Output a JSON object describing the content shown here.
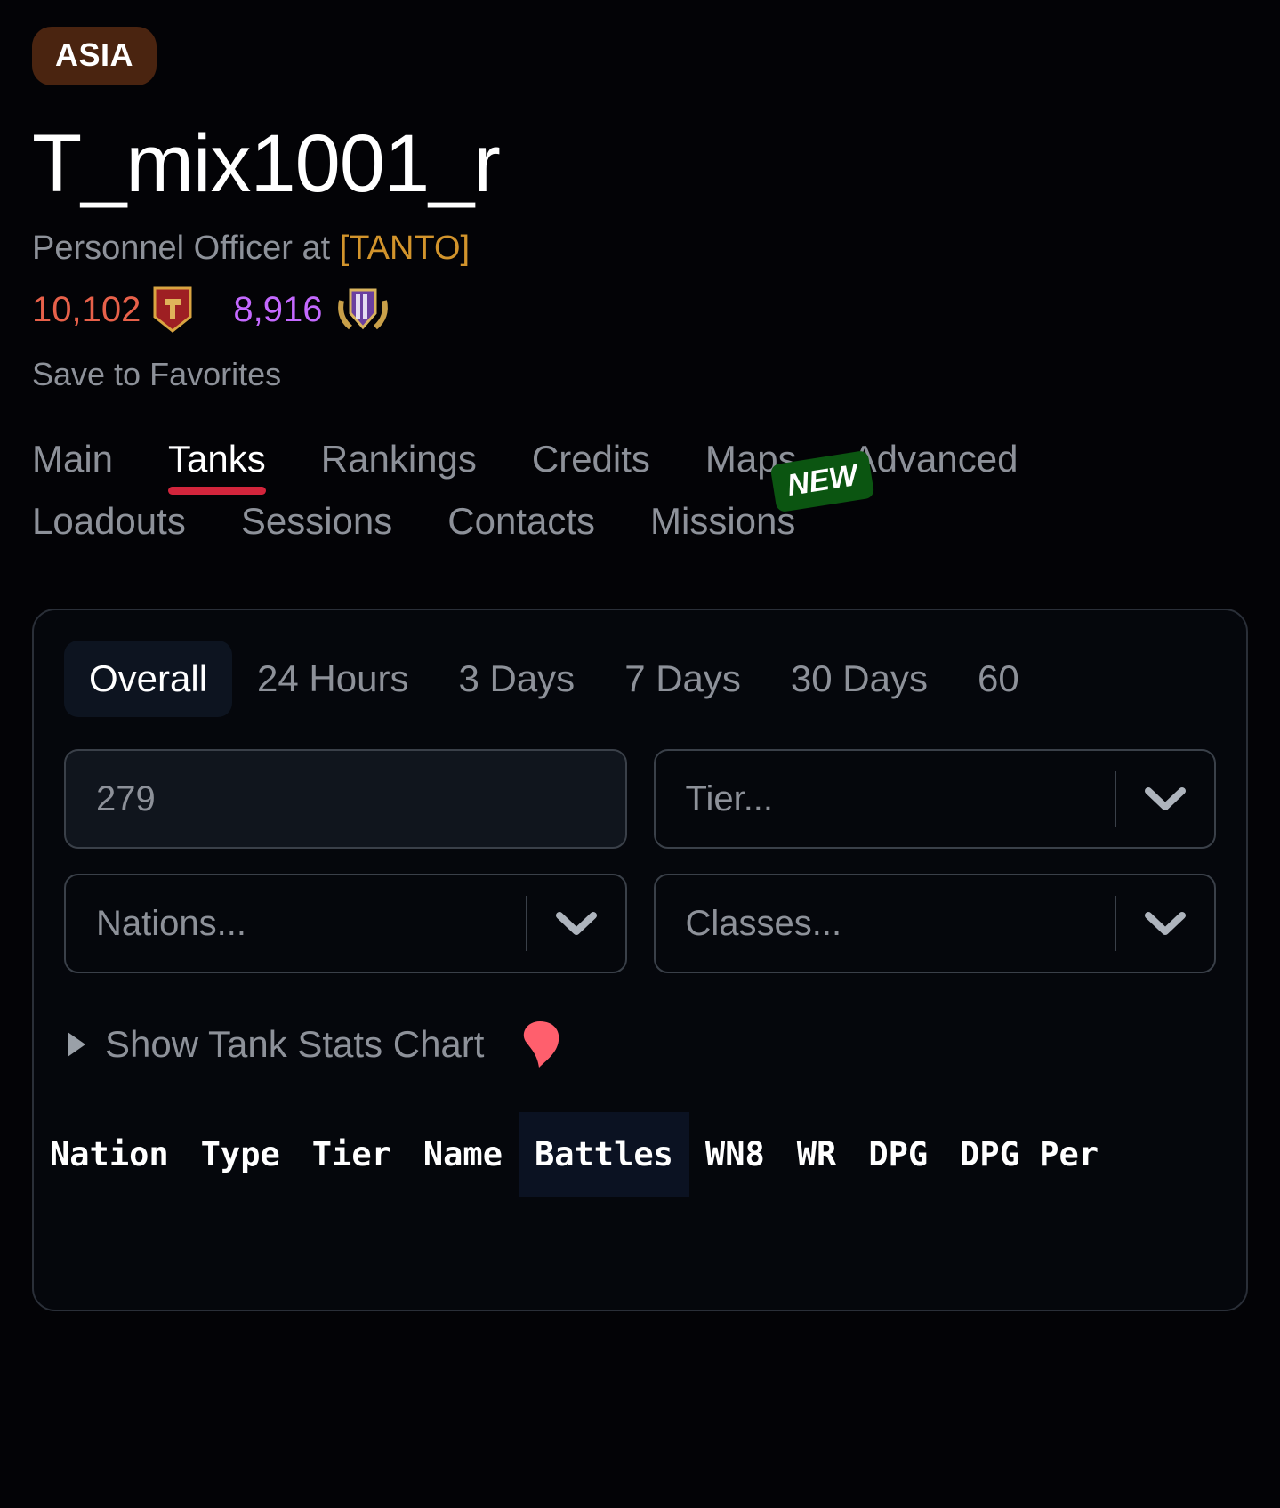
{
  "header": {
    "region_badge": "ASIA",
    "username": "T_mix1001_r",
    "role_prefix": "Personnel Officer at ",
    "clan_tag": "[TANTO]",
    "battles_value": "10,102",
    "wn8_value": "8,916",
    "save_favorites": "Save to Favorites",
    "colors": {
      "region_badge_bg": "#4a2410",
      "clan_tag": "#d2942c",
      "battles": "#e8614a",
      "wn8": "#c469ff"
    }
  },
  "nav": {
    "tabs_row1": [
      {
        "label": "Main",
        "active": false
      },
      {
        "label": "Tanks",
        "active": true
      },
      {
        "label": "Rankings",
        "active": false
      },
      {
        "label": "Credits",
        "active": false
      },
      {
        "label": "Maps",
        "active": false
      },
      {
        "label": "Advanced",
        "active": false
      }
    ],
    "tabs_row2": [
      {
        "label": "Loadouts",
        "active": false
      },
      {
        "label": "Sessions",
        "active": false
      },
      {
        "label": "Contacts",
        "active": false
      },
      {
        "label": "Missions",
        "active": false
      }
    ],
    "new_badge": "NEW",
    "active_underline_color": "#d3253c",
    "new_badge_color": "#0b5511"
  },
  "card": {
    "periods": [
      {
        "label": "Overall",
        "active": true
      },
      {
        "label": "24 Hours",
        "active": false
      },
      {
        "label": "3 Days",
        "active": false
      },
      {
        "label": "7 Days",
        "active": false
      },
      {
        "label": "30 Days",
        "active": false
      },
      {
        "label": "60",
        "active": false
      }
    ],
    "filters": {
      "search_value": "279",
      "tier_placeholder": "Tier...",
      "nations_placeholder": "Nations...",
      "classes_placeholder": "Classes..."
    },
    "chart_toggle": {
      "label": "Show Tank Stats Chart",
      "expanded": false,
      "icon_color": "#ff5f6d"
    },
    "table_headers": [
      {
        "label": "Nation",
        "sorted": false
      },
      {
        "label": "Type",
        "sorted": false
      },
      {
        "label": "Tier",
        "sorted": false
      },
      {
        "label": "Name",
        "sorted": false
      },
      {
        "label": "Battles",
        "sorted": true
      },
      {
        "label": "WN8",
        "sorted": false
      },
      {
        "label": "WR",
        "sorted": false
      },
      {
        "label": "DPG",
        "sorted": false
      },
      {
        "label": "DPG Per",
        "sorted": false
      }
    ]
  }
}
